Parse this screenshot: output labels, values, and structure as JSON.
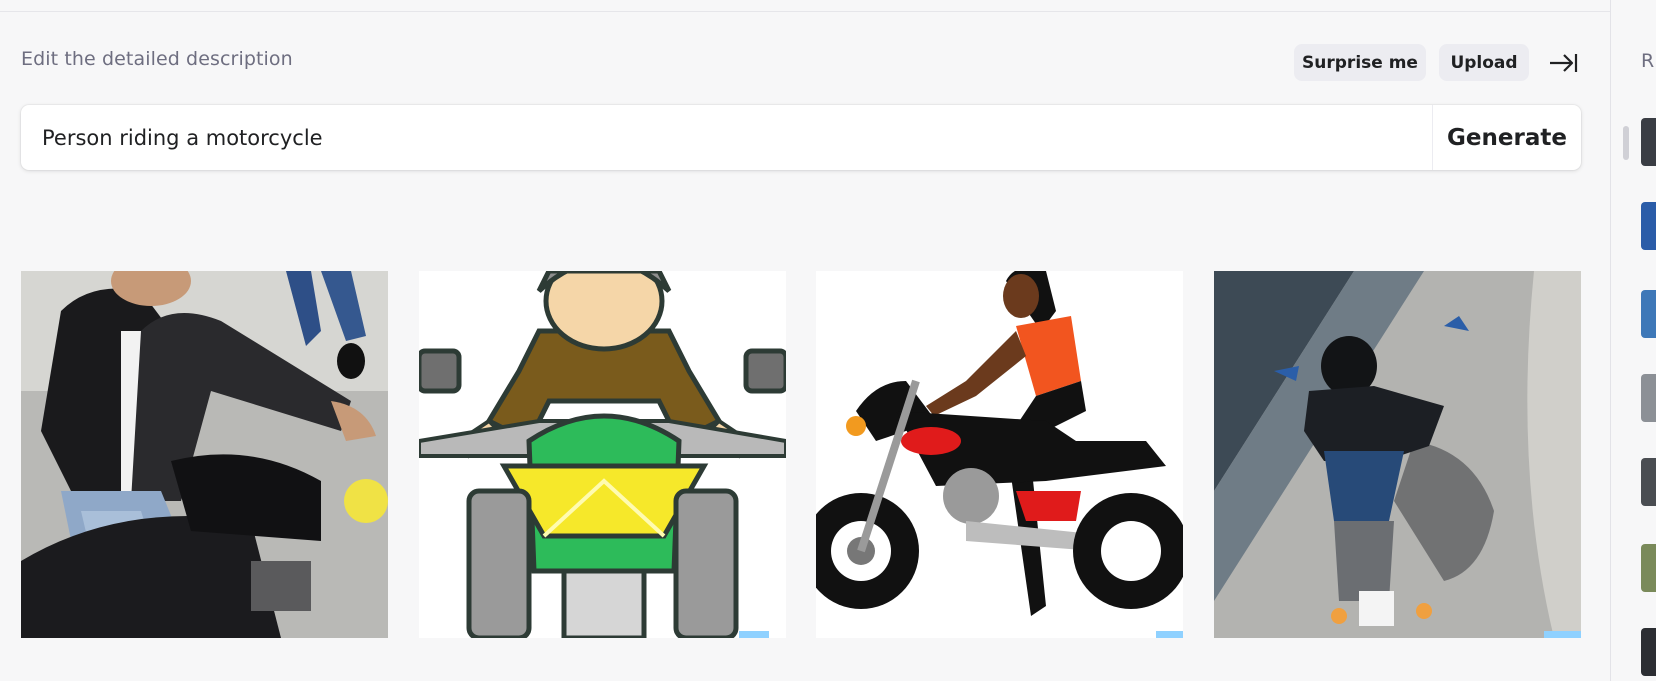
{
  "editor": {
    "description_label": "Edit the detailed description",
    "surprise_label": "Surprise me",
    "upload_label": "Upload",
    "prompt_value": "Person riding a motorcycle",
    "generate_label": "Generate"
  },
  "results": [
    {
      "alt": "Photo of a man in a leather jacket on a motorcycle"
    },
    {
      "alt": "Cartoon rider on a green motorcycle"
    },
    {
      "alt": "Illustration of a woman riding a motorcycle"
    },
    {
      "alt": "Overhead photo of a rider on a motorcycle"
    }
  ],
  "sidebar": {
    "heading": "R",
    "thumbnails": 7
  },
  "colors": {
    "accent_green": "#10a37f",
    "background": "#f7f7f8",
    "pill": "#ececf1"
  }
}
